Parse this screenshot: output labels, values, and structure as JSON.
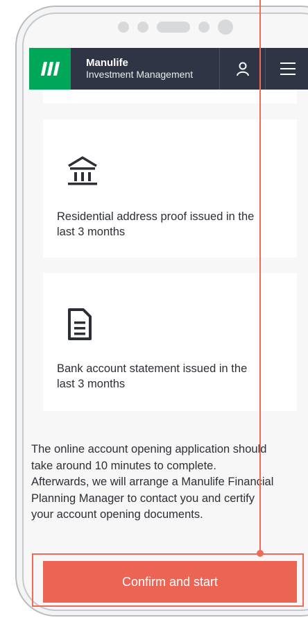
{
  "app": {
    "brand_name": "Manulife",
    "brand_sub": "Investment Management"
  },
  "header": {
    "icons": [
      "user-icon",
      "menu-icon"
    ]
  },
  "documents": [
    {
      "icon": "bank-building-icon",
      "text_line1": "Residential address proof issued in the",
      "text_line2": "last 3 months"
    },
    {
      "icon": "document-icon",
      "text_line1": "Bank account statement issued in the",
      "text_line2": "last 3 months"
    }
  ],
  "info": {
    "line1": "The online account opening application should",
    "line2": "take around 10 minutes to complete.",
    "line3": "Afterwards, we will arrange a Manulife Financial",
    "line4": "Planning Manager to contact you and certify",
    "line5": "your account opening documents."
  },
  "cta": {
    "label": "Confirm and start"
  },
  "colors": {
    "header_bg": "#2f3545",
    "brand_green": "#00a758",
    "cta": "#ec6453",
    "annotation": "#ef6b57"
  }
}
